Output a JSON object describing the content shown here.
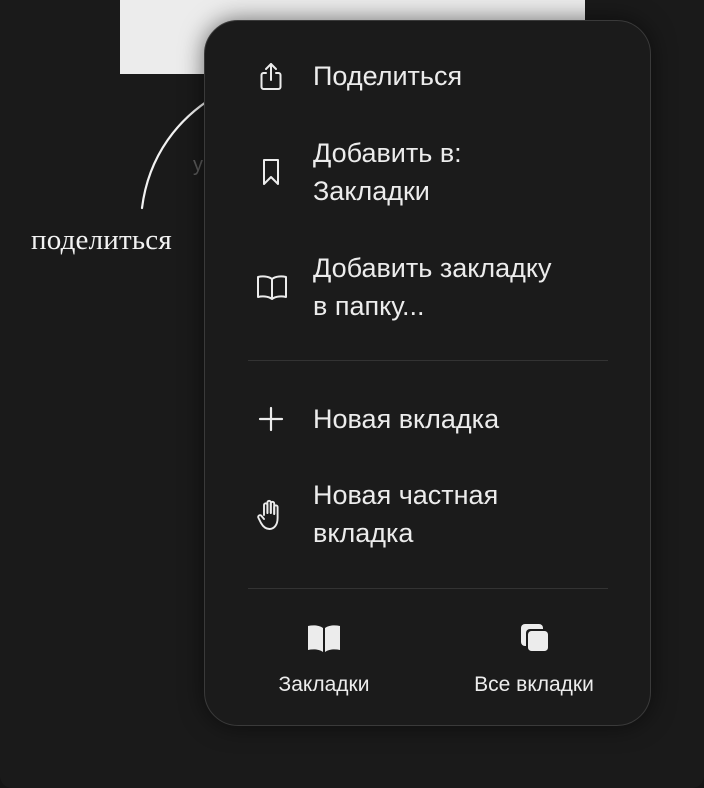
{
  "annotation": {
    "text": "поделиться"
  },
  "background": {
    "partial_letter": "у"
  },
  "menu": {
    "items": [
      {
        "label": "Поделиться",
        "icon": "share-icon"
      },
      {
        "label": "Добавить в:\nЗакладки",
        "icon": "bookmark-icon"
      },
      {
        "label": "Добавить закладку\nв папку...",
        "icon": "book-open-icon"
      },
      {
        "label": "Новая вкладка",
        "icon": "plus-icon"
      },
      {
        "label": "Новая частная\nвкладка",
        "icon": "hand-icon"
      }
    ],
    "bottom": [
      {
        "label": "Закладки",
        "icon": "bookmarks-book-icon"
      },
      {
        "label": "Все вкладки",
        "icon": "tabs-stack-icon"
      }
    ]
  },
  "colors": {
    "menu_bg": "#1b1b1b",
    "text": "#ececec",
    "page_bg": "#1a1a1a"
  }
}
